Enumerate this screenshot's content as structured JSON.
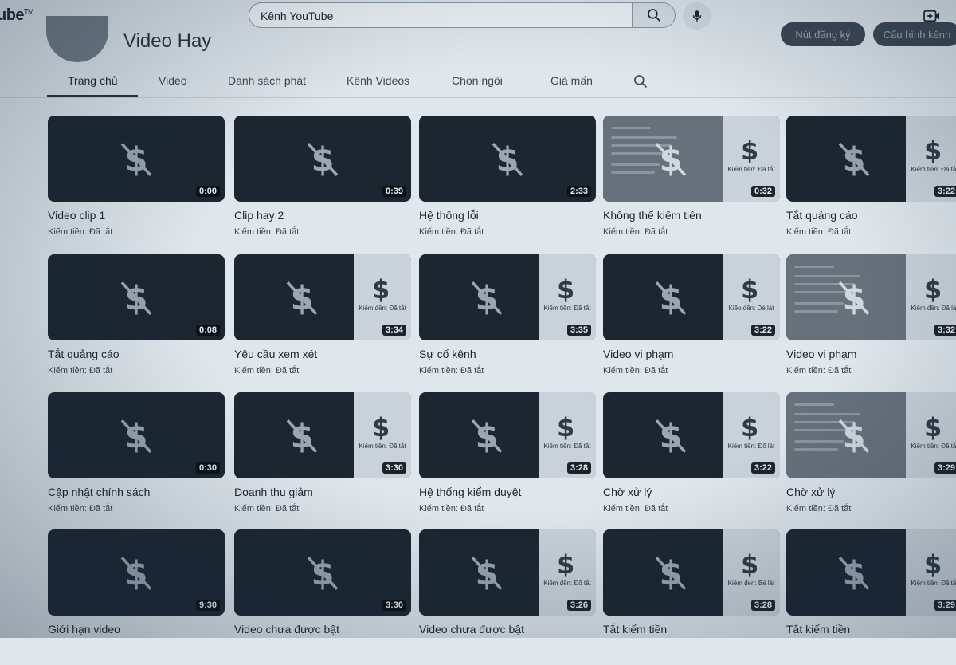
{
  "header": {
    "logo_text": "ube",
    "logo_tm": "TM",
    "search_value": "Kênh YouTube",
    "icons": [
      "search-icon",
      "mic-icon",
      "create-video-icon"
    ]
  },
  "channel": {
    "name": "Video Hay",
    "button1_label": "Nút đăng ký",
    "button2_label": "Cấu hình kênh"
  },
  "tabs": [
    {
      "label": "Trang chủ",
      "active": true
    },
    {
      "label": "Video"
    },
    {
      "label": "Danh sách phát"
    },
    {
      "label": "Kênh Videos"
    },
    {
      "label": "Chon ngôi"
    },
    {
      "label": "Giá mấn"
    }
  ],
  "videos": [
    {
      "title": "Video clip 1",
      "meta": "Kiếm tiền: Đã tắt",
      "duration": "0:00",
      "panel": false,
      "panel_text": ""
    },
    {
      "title": "Clip hay 2",
      "meta": "Kiếm tiền: Đã tắt",
      "duration": "0:39",
      "panel": false,
      "panel_text": ""
    },
    {
      "title": "Hệ thống lỗi",
      "meta": "Kiếm tiền: Đã tắt",
      "duration": "2:33",
      "panel": false,
      "panel_text": ""
    },
    {
      "title": "Không thể kiếm tiền",
      "meta": "Kiếm tiền: Đã tắt",
      "duration": "0:32",
      "panel": true,
      "panel_text": "Kiếm tiền: Đã tắt",
      "screenshot": true
    },
    {
      "title": "Tắt quảng cáo",
      "meta": "Kiếm tiền: Đã tắt",
      "duration": "3:22",
      "panel": true,
      "panel_text": "Kiếm tiền: Đã tắt"
    },
    {
      "title": "Tắt quảng cáo",
      "meta": "Kiếm tiền: Đã tắt",
      "duration": "0:08",
      "panel": false,
      "panel_text": ""
    },
    {
      "title": "Yêu cầu xem xét",
      "meta": "Kiếm tiền: Đã tắt",
      "duration": "3:34",
      "panel": true,
      "panel_text": "Kiếm đền: Đã tắt"
    },
    {
      "title": "Sự cố kênh",
      "meta": "Kiếm tiền: Đã tắt",
      "duration": "3:35",
      "panel": true,
      "panel_text": "Kiếm tiền: Đã tắt"
    },
    {
      "title": "Video vi phạm",
      "meta": "Kiếm tiền: Đã tắt",
      "duration": "3:22",
      "panel": true,
      "panel_text": "Kiếo đền: Dé lát"
    },
    {
      "title": "Video vi phạm",
      "meta": "Kiếm tiền: Đã tắt",
      "duration": "3:32",
      "panel": true,
      "panel_text": "Kiếm đền: Đã lát",
      "screenshot": true
    },
    {
      "title": "Cập nhật chính sách",
      "meta": "Kiếm tiền: Đã tắt",
      "duration": "0:30",
      "panel": false,
      "panel_text": ""
    },
    {
      "title": "Doanh thu giảm",
      "meta": "Kiếm tiền: Đã tắt",
      "duration": "3:30",
      "panel": true,
      "panel_text": "Kiếm tiền: Đã tắt"
    },
    {
      "title": "Hệ thống kiểm duyệt",
      "meta": "Kiếm tiền: Đã tắt",
      "duration": "3:28",
      "panel": true,
      "panel_text": "Kiếm tiền: Đã tắt"
    },
    {
      "title": "Chờ xử lý",
      "meta": "Kiếm tiền: Đã tắt",
      "duration": "3:22",
      "panel": true,
      "panel_text": "Kiếm tiền: Đõ lát"
    },
    {
      "title": "Chờ xử lý",
      "meta": "Kiếm tiền: Đã tắt",
      "duration": "3:29",
      "panel": true,
      "panel_text": "Kiếm tiền: Đã tắt",
      "screenshot": true
    },
    {
      "title": "Giới hạn video",
      "meta": "",
      "duration": "9:30",
      "panel": false,
      "panel_text": ""
    },
    {
      "title": "Video chưa được bật",
      "meta": "",
      "duration": "3:30",
      "panel": false,
      "panel_text": ""
    },
    {
      "title": "Video chưa được bật",
      "meta": "",
      "duration": "3:26",
      "panel": true,
      "panel_text": "Kiếm đền: Đõ tắt"
    },
    {
      "title": "Tắt kiếm tiền",
      "meta": "",
      "duration": "3:28",
      "panel": true,
      "panel_text": "Kiếm đen: Bé lát"
    },
    {
      "title": "Tắt kiếm tiền",
      "meta": "",
      "duration": "3:29",
      "panel": true,
      "panel_text": "Kiếm tiền: Đã tắt"
    }
  ]
}
